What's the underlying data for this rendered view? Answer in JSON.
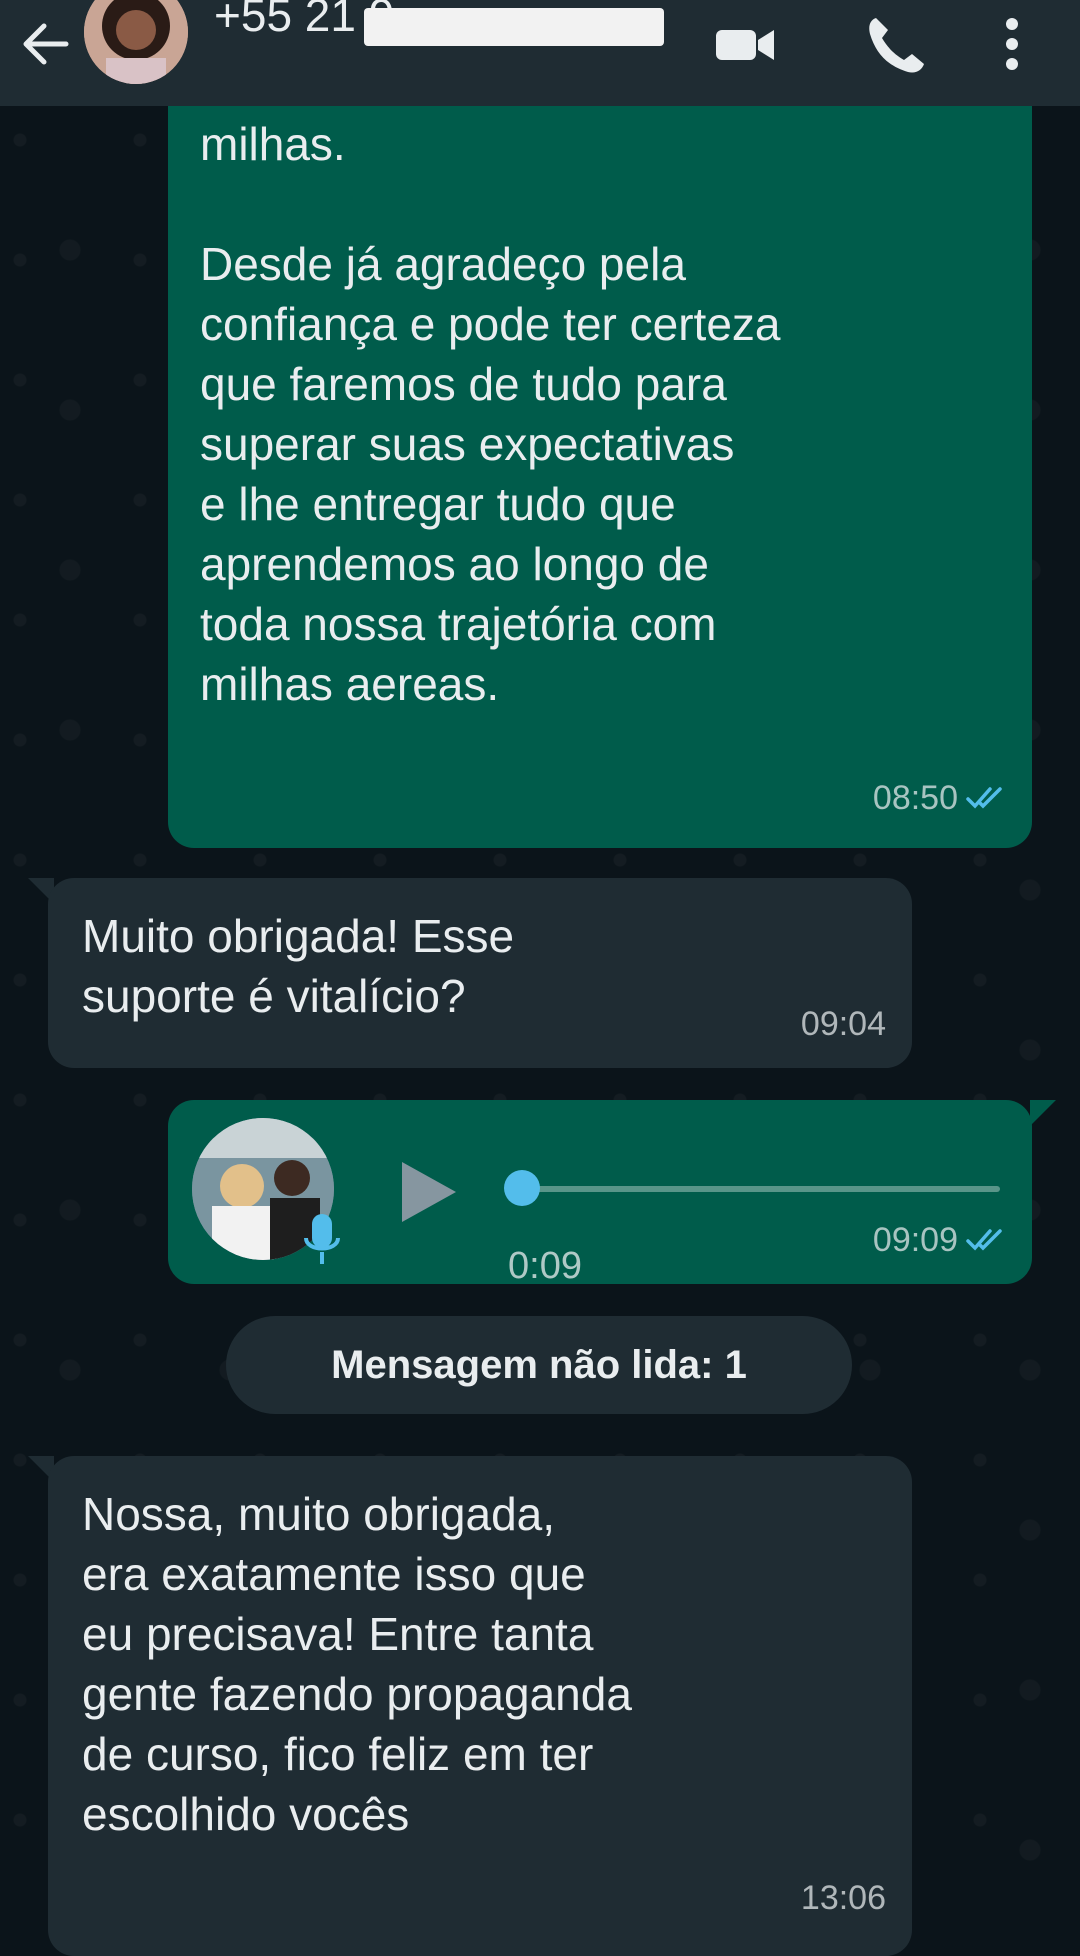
{
  "header": {
    "title": "+55 21 9",
    "back_icon": "arrow-left-icon",
    "video_icon": "video-call-icon",
    "call_icon": "phone-icon",
    "menu_icon": "more-vert-icon"
  },
  "messages": [
    {
      "direction": "outgoing",
      "text": "milhas.\n\nDesde já agradeço pela\nconfiança e pode ter certeza\nque faremos de tudo para\nsuperar suas expectativas\ne lhe entregar tudo que\naprendemos ao longo de\ntoda nossa trajetória com\nmilhas aereas.",
      "time": "08:50",
      "status": "read"
    },
    {
      "direction": "incoming",
      "text": "Muito obrigada! Esse\nsuporte é vitalício?",
      "time": "09:04"
    },
    {
      "direction": "outgoing",
      "type": "voice",
      "duration": "0:09",
      "progress": 0.0,
      "time": "09:09",
      "status": "read"
    },
    {
      "direction": "incoming",
      "text": "Nossa, muito obrigada,\nera exatamente isso que\neu precisava! Entre tanta\ngente fazendo propaganda\nde curso, fico feliz em ter\nescolhido vocês",
      "time": "13:06"
    }
  ],
  "unread_divider": "Mensagem não lida: 1",
  "colors": {
    "outgoing_bubble": "#005c4b",
    "incoming_bubble": "#1f2c33",
    "background": "#0b141a",
    "read_ticks": "#53bdeb"
  }
}
